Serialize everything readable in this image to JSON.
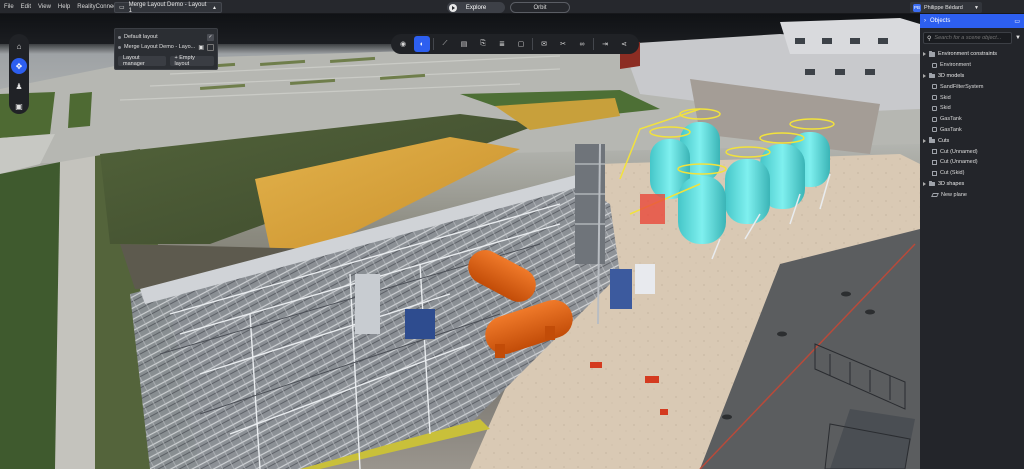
{
  "app": {
    "menu": [
      "File",
      "Edit",
      "View",
      "Help",
      "RealityConnect"
    ],
    "layout_selector": "Merge Layout Demo - Layout 1",
    "modes": {
      "explore": "Explore",
      "orbit": "Orbit"
    },
    "user": {
      "initials": "PB",
      "name": "Philippe Bédard"
    }
  },
  "layout_panel": {
    "items": [
      {
        "label": "Default layout"
      },
      {
        "label": "Merge Layout Demo - Layo..."
      }
    ],
    "buttons": {
      "manager": "Layout manager",
      "empty": "+ Empty layout"
    }
  },
  "objects_panel": {
    "title": "Objects",
    "search_placeholder": "Search for a scene object...",
    "tree": [
      {
        "label": "Environment constraints",
        "level": 0,
        "kind": "folder"
      },
      {
        "label": "Environment",
        "level": 1,
        "kind": "cube"
      },
      {
        "label": "3D models",
        "level": 0,
        "kind": "folder"
      },
      {
        "label": "SandFilterSystem",
        "level": 1,
        "kind": "cube"
      },
      {
        "label": "Skid",
        "level": 1,
        "kind": "cube"
      },
      {
        "label": "Skid",
        "level": 1,
        "kind": "cube"
      },
      {
        "label": "GasTank",
        "level": 1,
        "kind": "cube"
      },
      {
        "label": "GasTank",
        "level": 1,
        "kind": "cube"
      },
      {
        "label": "Cuts",
        "level": 0,
        "kind": "folder"
      },
      {
        "label": "Cut (Unnamed)",
        "level": 1,
        "kind": "cut"
      },
      {
        "label": "Cut (Unnamed)",
        "level": 1,
        "kind": "cut"
      },
      {
        "label": "Cut (Skid)",
        "level": 1,
        "kind": "cut"
      },
      {
        "label": "3D shapes",
        "level": 0,
        "kind": "folder"
      },
      {
        "label": "New plane",
        "level": 1,
        "kind": "plane"
      }
    ]
  },
  "colors": {
    "accent": "#2d5ff0",
    "tank_cyan": "#5fe0e0",
    "tank_orange": "#e2600f",
    "field_yellow": "#d7a13a"
  }
}
